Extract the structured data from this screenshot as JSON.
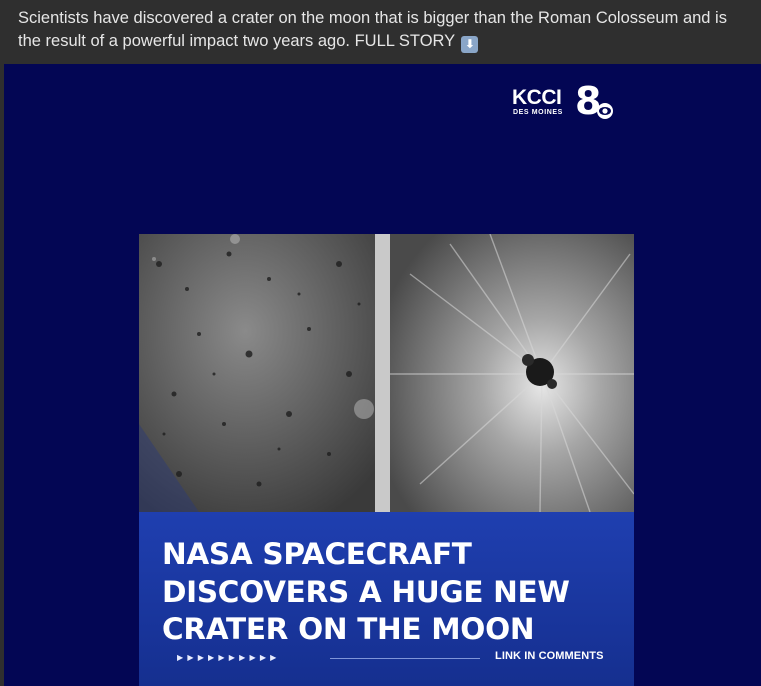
{
  "post": {
    "caption": "Scientists have discovered a crater on the moon that is bigger than the Roman Colosseum and is the result of a powerful impact two years ago. FULL STORY",
    "caption_emoji": "⬇"
  },
  "image": {
    "logo_text": "KCCI",
    "logo_subtext": "DES MOINES",
    "headline_line1": "NASA SPACECRAFT",
    "headline_line2": "DISCOVERS A HUGE NEW",
    "headline_line3": "CRATER ON THE MOON",
    "arrows": "▶▶▶▶▶▶▶▶▶▶",
    "link_label": "LINK IN COMMENTS"
  },
  "colors": {
    "background": "#2f2f2f",
    "frame": "#030654",
    "band": "#1f3fb0"
  }
}
